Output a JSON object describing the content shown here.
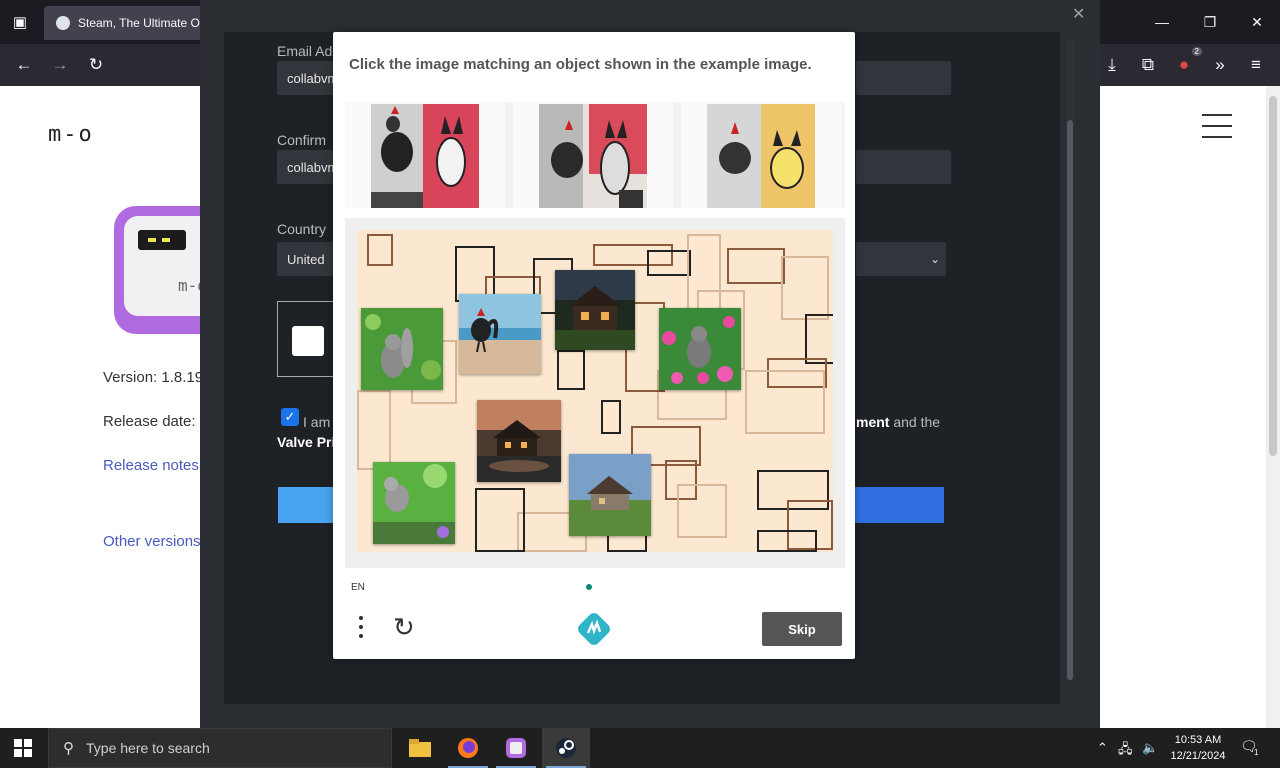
{
  "browser": {
    "tab_title": "Steam, The Ultimate Or",
    "toolbar_badge": "2"
  },
  "page": {
    "logo": "m-o",
    "app_icon_mark": "m-o",
    "version": "Version: 1.8.19",
    "release_date": "Release date:",
    "release_notes": "Release notes",
    "other_versions": "Other versions"
  },
  "steam": {
    "email_label": "Email Ad",
    "email_value": "collabvm",
    "confirm_label": "Confirm",
    "confirm_value": "collabvm",
    "country_label": "Country",
    "country_value": "United",
    "agree_left": "I am",
    "agree_right": "ment and the",
    "valve_privacy": "Valve Pri"
  },
  "captcha": {
    "instruction": "Click the image matching an object shown in the example image.",
    "language": "EN",
    "skip_label": "Skip"
  },
  "taskbar": {
    "search_placeholder": "Type here to search",
    "time": "10:53 AM",
    "date": "12/21/2024",
    "notification_count": "1"
  },
  "colors": {
    "steam_bg": "#2a2d31",
    "skip_button": "#555555",
    "link": "#4a5bbd",
    "captcha_accent": "#0a8a7c"
  }
}
